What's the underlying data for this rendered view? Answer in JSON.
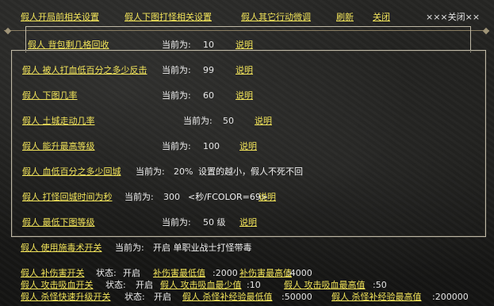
{
  "top_menu": {
    "start_settings": "假人开局前相关设置",
    "map_farm_settings": "假人下图打怪相关设置",
    "other_actions": "假人其它行动微调",
    "refresh": "刷新",
    "close": "关闭",
    "close_right": "×××关闭××"
  },
  "rows": [
    {
      "link": "假人 背包剩几格回收",
      "label": "当前为:",
      "value": "10",
      "help": "说明"
    },
    {
      "link": "假人 被人打血低百分之多少反击",
      "label": "当前为:",
      "value": "99",
      "help": "说明"
    },
    {
      "link": "假人 下图几率",
      "label": "当前为:",
      "value": "60",
      "help": "说明"
    },
    {
      "link": "假人 土城走动几率",
      "label": "当前为:",
      "value": "50",
      "help": "说明"
    },
    {
      "link": "假人 能升最高等级",
      "label": "当前为:",
      "value": "100",
      "help": "说明"
    },
    {
      "link": "假人 血低百分之多少回城",
      "label": "当前为:",
      "value": "20%",
      "note": "设置的越小，假人不死不回"
    },
    {
      "link": "假人 打怪回城时间为秒",
      "label": "当前为:",
      "value": "300",
      "note": "<秒/FCOLOR=69>",
      "help": "说明"
    },
    {
      "link": "假人 最低下图等级",
      "label": "当前为:",
      "value": "50 级",
      "help": "说明"
    }
  ],
  "poison": {
    "link": "假人 使用施毒术开关",
    "label": "当前为:",
    "value": "开启 单职业战士打怪带毒"
  },
  "bottom": [
    {
      "link": "假人 补伤害开关",
      "status_label": "状态:",
      "status": "开启",
      "min_link": "补伤害最低值",
      "min_value": ":2000",
      "max_link": "补伤害最高值",
      "max_value": ":4000"
    },
    {
      "link": "假人 攻击吸血开关",
      "status_label": "状态:",
      "status": "开启",
      "min_link": "假人 攻击吸血最少值",
      "min_value": ":10",
      "max_link": "假人 攻击吸血最高值",
      "max_value": ":50"
    },
    {
      "link": "假人 杀怪快速升级开关",
      "status_label": "状态:",
      "status": "开启",
      "min_link": "假人 杀怪补经验最低值",
      "min_value": ":50000",
      "max_link": "假人 杀怪补经验最高值",
      "max_value": ":200000"
    }
  ]
}
